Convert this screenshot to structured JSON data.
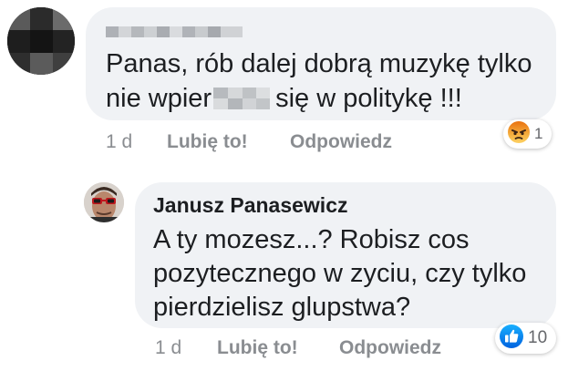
{
  "comment": {
    "author_blurred": true,
    "text_line1": "Panas, rób dalej dobrą muzykę tylko",
    "text_line2_before": "nie wpier",
    "text_line2_after": "się w politykę !!!",
    "time": "1 d",
    "like_label": "Lubię to!",
    "reply_label": "Odpowiedz",
    "reaction_icon": "angry-face-icon",
    "reaction_count": "1"
  },
  "reply": {
    "author": "Janusz Panasewicz",
    "text_line1": "A ty mozesz...? Robisz cos",
    "text_line2": "pozytecznego w zyciu, czy tylko",
    "text_line3": "pierdzielisz glupstwa?",
    "time": "1 d",
    "like_label": "Lubię to!",
    "reply_label": "Odpowiedz",
    "reaction_icon": "thumbs-up-icon",
    "reaction_count": "10"
  },
  "colors": {
    "bubble_bg": "#f0f2f5",
    "meta_text": "#8a8d91",
    "like_blue": "#1877f2",
    "angry_top": "#e9710f"
  }
}
